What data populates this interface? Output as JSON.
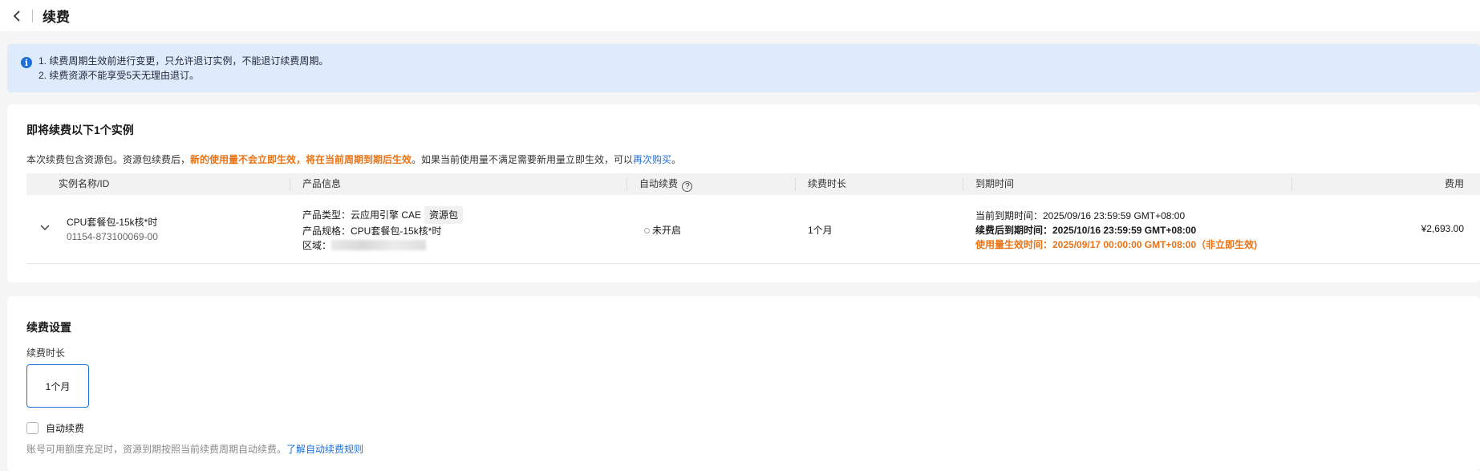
{
  "header": {
    "title": "续费"
  },
  "notice": {
    "lines": [
      "1. 续费周期生效前进行变更，只允许退订实例，不能退订续费周期。",
      "2. 续费资源不能享受5天无理由退订。"
    ]
  },
  "instances": {
    "title": "即将续费以下1个实例",
    "desc_before": "本次续费包含资源包。资源包续费后，",
    "desc_highlight": "新的使用量不会立即生效，将在当前周期到期后生效",
    "desc_after": "。如果当前使用量不满足需要新用量立即生效，可以",
    "desc_link": "再次购买",
    "desc_end": "。",
    "columns": [
      "实例名称/ID",
      "产品信息",
      "自动续费",
      "续费时长",
      "到期时间",
      "费用"
    ],
    "row": {
      "name": "CPU套餐包-15k核*时",
      "id": "01154-873100069-00",
      "product_type_label": "产品类型：",
      "product_type": "云应用引擎 CAE",
      "product_tag": "资源包",
      "spec_label": "产品规格：",
      "spec": "CPU套餐包-15k核*时",
      "region_label": "区域：",
      "auto_renew": "未开启",
      "duration": "1个月",
      "expire_current": "当前到期时间：2025/09/16 23:59:59 GMT+08:00",
      "expire_after": "续费后到期时间：2025/10/16 23:59:59 GMT+08:00",
      "effective": "使用量生效时间：2025/09/17 00:00:00 GMT+08:00（非立即生效)",
      "fee": "¥2,693.00"
    }
  },
  "settings": {
    "title": "续费设置",
    "duration_label": "续费时长",
    "duration_option": "1个月",
    "auto_renew_label": "自动续费",
    "hint": "账号可用额度充足时，资源到期按照当前续费周期自动续费。",
    "hint_link": "了解自动续费规则"
  },
  "colors": {
    "accent": "#1e6fd9",
    "warning": "#e97316",
    "info_bg": "#deebfd"
  }
}
